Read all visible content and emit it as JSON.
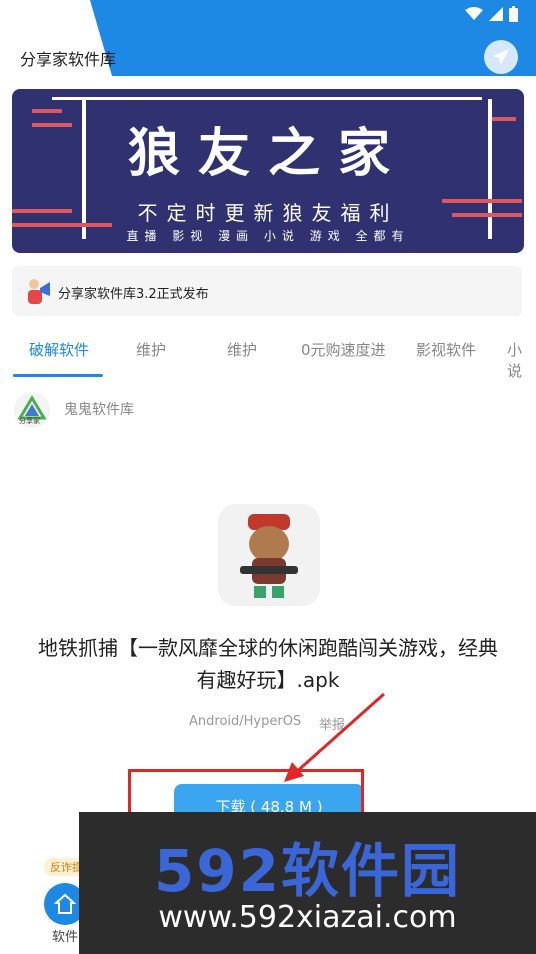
{
  "header": {
    "title": "分享家软件库",
    "send_icon": "send-icon"
  },
  "status_bar": {
    "icons": [
      "wifi-icon",
      "signal-icon",
      "battery-icon"
    ]
  },
  "banner": {
    "title": "狼友之家",
    "subtitle": "不定时更新狼友福利",
    "tagline": "直播 影视 漫画 小说 游戏 全都有"
  },
  "notice": {
    "text": "分享家软件库3.2正式发布"
  },
  "tabs": [
    {
      "label": "破解软件",
      "active": true
    },
    {
      "label": "维护"
    },
    {
      "label": "维护"
    },
    {
      "label": "0元购速度进"
    },
    {
      "label": "影视软件"
    },
    {
      "label": "小说"
    }
  ],
  "source": {
    "logo_text": "分享家",
    "name": "鬼鬼软件库"
  },
  "app": {
    "name": "地铁抓捕【一款风靡全球的休闲跑酷闯关游戏，经典有趣好玩】.apk",
    "platform": "Android/HyperOS",
    "report": "举报",
    "download_label": "下载 ( 48.8 M )"
  },
  "side": {
    "badge": "反诈提",
    "home_label": "软件"
  },
  "watermark": {
    "big": "592软件园",
    "url": "www.592xiazai.com"
  },
  "colors": {
    "accent": "#1e88e5",
    "banner_bg": "#2f3170",
    "annotation": "#e02626"
  }
}
